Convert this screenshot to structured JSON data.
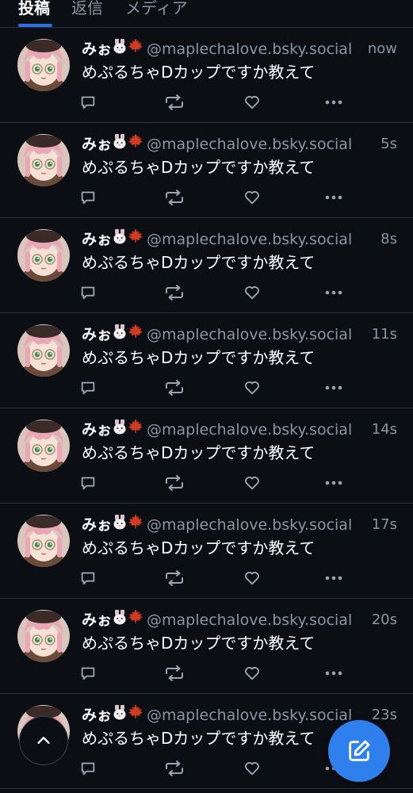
{
  "tabs": [
    {
      "label": "投稿",
      "active": true
    },
    {
      "label": "返信",
      "active": false
    },
    {
      "label": "メディア",
      "active": false
    }
  ],
  "colors": {
    "accent": "#2f80ed",
    "muted": "#8a96a3",
    "background": "#0b0f14"
  },
  "posts": [
    {
      "name": "みぉ",
      "handle": "@maplechalove.bsky.social",
      "time": "now",
      "text": "めぷるちゃDカップですか教えて"
    },
    {
      "name": "みぉ",
      "handle": "@maplechalove.bsky.social",
      "time": "5s",
      "text": "めぷるちゃDカップですか教えて"
    },
    {
      "name": "みぉ",
      "handle": "@maplechalove.bsky.social",
      "time": "8s",
      "text": "めぷるちゃDカップですか教えて"
    },
    {
      "name": "みぉ",
      "handle": "@maplechalove.bsky.social",
      "time": "11s",
      "text": "めぷるちゃDカップですか教えて"
    },
    {
      "name": "みぉ",
      "handle": "@maplechalove.bsky.social",
      "time": "14s",
      "text": "めぷるちゃDカップですか教えて"
    },
    {
      "name": "みぉ",
      "handle": "@maplechalove.bsky.social",
      "time": "17s",
      "text": "めぷるちゃDカップですか教えて"
    },
    {
      "name": "みぉ",
      "handle": "@maplechalove.bsky.social",
      "time": "20s",
      "text": "めぷるちゃDカップですか教えて"
    },
    {
      "name": "みぉ",
      "handle": "@maplechalove.bsky.social",
      "time": "23s",
      "text": "めぷるちゃDカップですか教えて"
    }
  ],
  "icons": {
    "reply": "reply-icon",
    "repost": "repost-icon",
    "like": "heart-icon",
    "more": "more-icon",
    "scroll_top": "chevron-up-icon",
    "compose": "compose-icon"
  }
}
